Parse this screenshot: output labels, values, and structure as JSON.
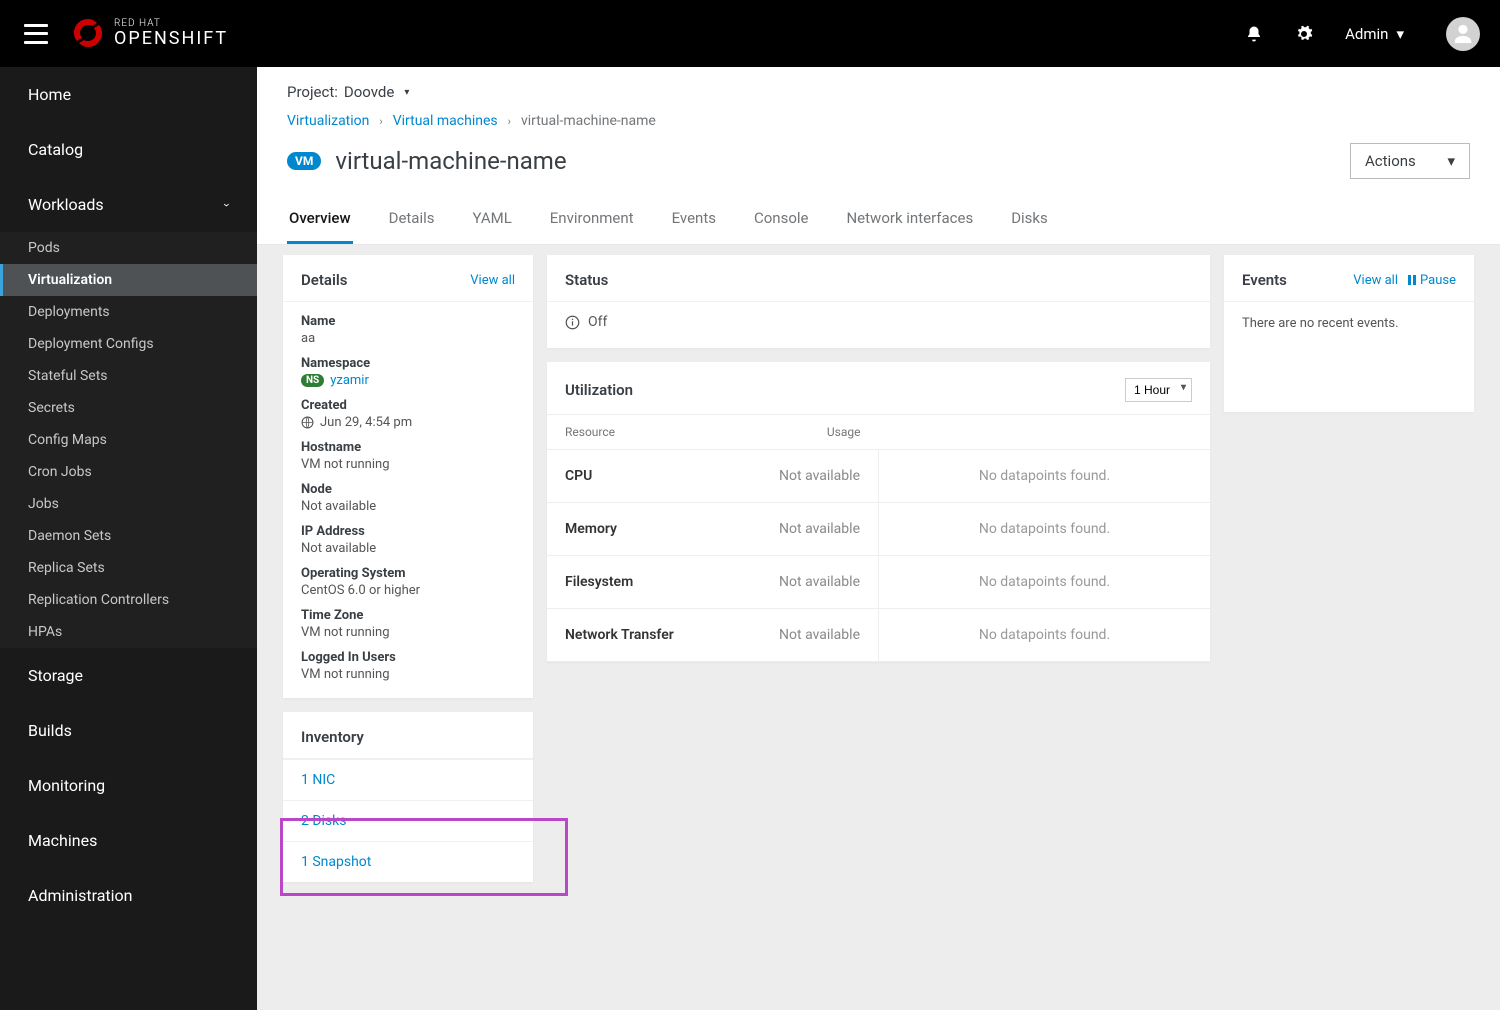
{
  "brand": {
    "line1": "RED HAT",
    "line2": "OPENSHIFT"
  },
  "topbar": {
    "user_role": "Admin"
  },
  "sidebar": {
    "sections": [
      {
        "label": "Home"
      },
      {
        "label": "Catalog"
      },
      {
        "label": "Workloads",
        "expanded": true,
        "items": [
          "Pods",
          "Virtualization",
          "Deployments",
          "Deployment Configs",
          "Stateful Sets",
          "Secrets",
          "Config Maps",
          "Cron Jobs",
          "Jobs",
          "Daemon Sets",
          "Replica Sets",
          "Replication Controllers",
          "HPAs"
        ],
        "active": "Virtualization"
      },
      {
        "label": "Storage"
      },
      {
        "label": "Builds"
      },
      {
        "label": "Monitoring"
      },
      {
        "label": "Machines"
      },
      {
        "label": "Administration"
      }
    ]
  },
  "project": {
    "label": "Project:",
    "name": "Doovde"
  },
  "breadcrumbs": [
    {
      "text": "Virtualization",
      "link": true
    },
    {
      "text": "Virtual machines",
      "link": true
    },
    {
      "text": "virtual-machine-name",
      "link": false
    }
  ],
  "page": {
    "badge": "VM",
    "title": "virtual-machine-name",
    "actions_label": "Actions"
  },
  "tabs": [
    "Overview",
    "Details",
    "YAML",
    "Environment",
    "Events",
    "Console",
    "Network interfaces",
    "Disks"
  ],
  "active_tab": "Overview",
  "details": {
    "title": "Details",
    "view_all": "View all",
    "name_lbl": "Name",
    "name": "aa",
    "ns_lbl": "Namespace",
    "ns_badge": "NS",
    "ns": "yzamir",
    "created_lbl": "Created",
    "created": "Jun 29, 4:54 pm",
    "host_lbl": "Hostname",
    "host": "VM not running",
    "node_lbl": "Node",
    "node": "Not available",
    "ip_lbl": "IP Address",
    "ip": "Not available",
    "os_lbl": "Operating System",
    "os": "CentOS 6.0 or higher",
    "tz_lbl": "Time Zone",
    "tz": "VM not running",
    "users_lbl": "Logged In Users",
    "users": "VM not running"
  },
  "status": {
    "title": "Status",
    "value": "Off"
  },
  "utilization": {
    "title": "Utilization",
    "range": "1 Hour",
    "columns": {
      "c1": "Resource",
      "c2": "Usage"
    },
    "rows": [
      {
        "name": "CPU",
        "usage": "Not available",
        "chart": "No datapoints found."
      },
      {
        "name": "Memory",
        "usage": "Not available",
        "chart": "No datapoints found."
      },
      {
        "name": "Filesystem",
        "usage": "Not available",
        "chart": "No datapoints found."
      },
      {
        "name": "Network Transfer",
        "usage": "Not available",
        "chart": "No datapoints found."
      }
    ]
  },
  "events": {
    "title": "Events",
    "view_all": "View all",
    "pause": "Pause",
    "empty": "There are no recent events."
  },
  "inventory": {
    "title": "Inventory",
    "items": [
      "1 NIC",
      "2 Disks",
      "1 Snapshot"
    ]
  }
}
